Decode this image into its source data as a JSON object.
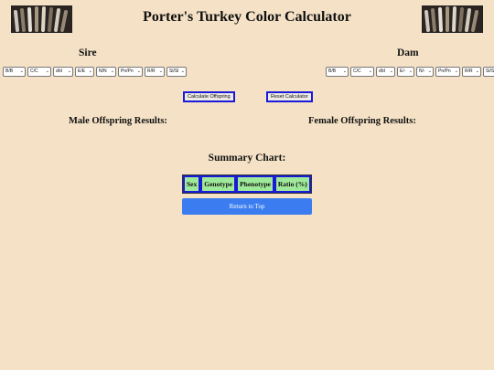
{
  "header": {
    "title": "Porter's Turkey Color Calculator"
  },
  "sire": {
    "label": "Sire",
    "selects": [
      "B/B",
      "C/C",
      "d/d",
      "E/E",
      "N/N",
      "Pn/Pn",
      "R/R",
      "Sl/Sl"
    ]
  },
  "dam": {
    "label": "Dam",
    "selects": [
      "B/B",
      "C/C",
      "d/d",
      "E/-",
      "N/-",
      "Pn/Pn",
      "R/R",
      "Sl/Sl"
    ]
  },
  "buttons": {
    "calculate": "Calculate Offspring",
    "reset": "Reset Calculator"
  },
  "results": {
    "male": "Male Offspring Results:",
    "female": "Female Offspring Results:"
  },
  "summary": {
    "title": "Summary Chart:",
    "columns": [
      "Sex",
      "Genotype",
      "Phenotype",
      "Ratio (%)"
    ]
  },
  "return_label": "Return to Top"
}
